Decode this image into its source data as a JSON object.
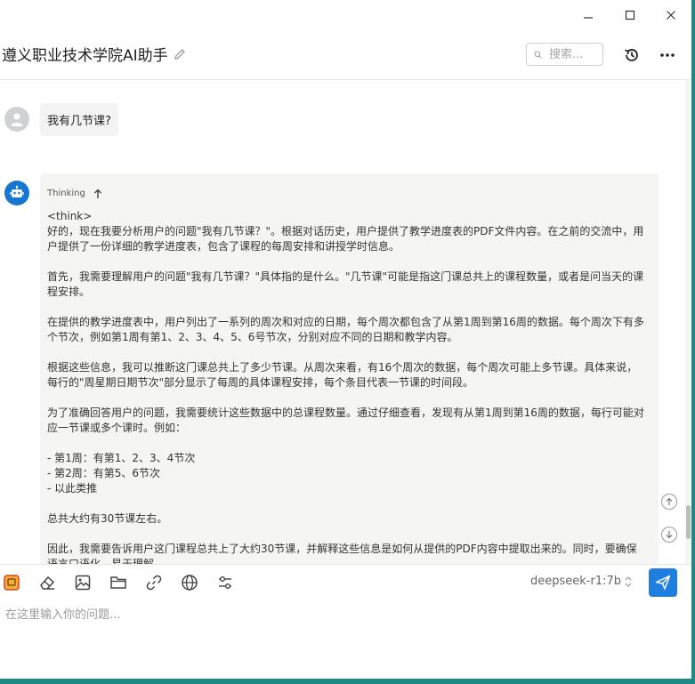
{
  "window": {
    "minimize_icon": "minimize-icon",
    "maximize_icon": "maximize-icon",
    "close_icon": "close-icon"
  },
  "header": {
    "title": "遵义职业技术学院AI助手",
    "search_placeholder": "搜索...",
    "history_icon": "history-icon",
    "more_icon": "more-icon"
  },
  "conversation": {
    "user_message": "我有几节课?",
    "thinking_label": "Thinking",
    "lines": [
      "<think>",
      "好的，现在我要分析用户的问题\"我有几节课？\"。根据对话历史，用户提供了教学进度表的PDF文件内容。在之前的交流中，用",
      "户提供了一份详细的教学进度表，包含了课程的每周安排和讲授学时信息。",
      "",
      "首先，我需要理解用户的问题\"我有几节课？\"具体指的是什么。\"几节课\"可能是指这门课总共上的课程数量，或者是问当天的课",
      "程安排。",
      "",
      "在提供的教学进度表中，用户列出了一系列的周次和对应的日期，每个周次都包含了从第1周到第16周的数据。每个周次下有多",
      "个节次，例如第1周有第1、2、3、4、5、6号节次，分别对应不同的日期和教学内容。",
      "",
      "根据这些信息，我可以推断这门课总共上了多少节课。从周次来看，有16个周次的数据，每个周次可能上多节课。具体来说，",
      "每行的\"周星期日期节次\"部分显示了每周的具体课程安排，每个条目代表一节课的时间段。",
      "",
      "为了准确回答用户的问题，我需要统计这些数据中的总课程数量。通过仔细查看，发现有从第1周到第16周的数据，每行可能对",
      "应一节课或多个课时。例如：",
      "",
      "- 第1周：有第1、2、3、4节次",
      "- 第2周：有第5、6节次",
      "- 以此类推",
      "",
      "总共大约有30节课左右。",
      "",
      "因此，我需要告诉用户这门课程总共上了大约30节课，并解释这些信息是如何从提供的PDF内容中提取出来的。同时，要确保",
      "语言口语化，易于理解。"
    ]
  },
  "toolbar": {
    "tools": [
      "assistant-icon",
      "eraser-icon",
      "image-icon",
      "folder-icon",
      "link-icon",
      "globe-icon",
      "settings-sliders-icon"
    ],
    "model": "deepseek-r1:7b"
  },
  "input": {
    "placeholder": "在这里输入你的问题..."
  }
}
